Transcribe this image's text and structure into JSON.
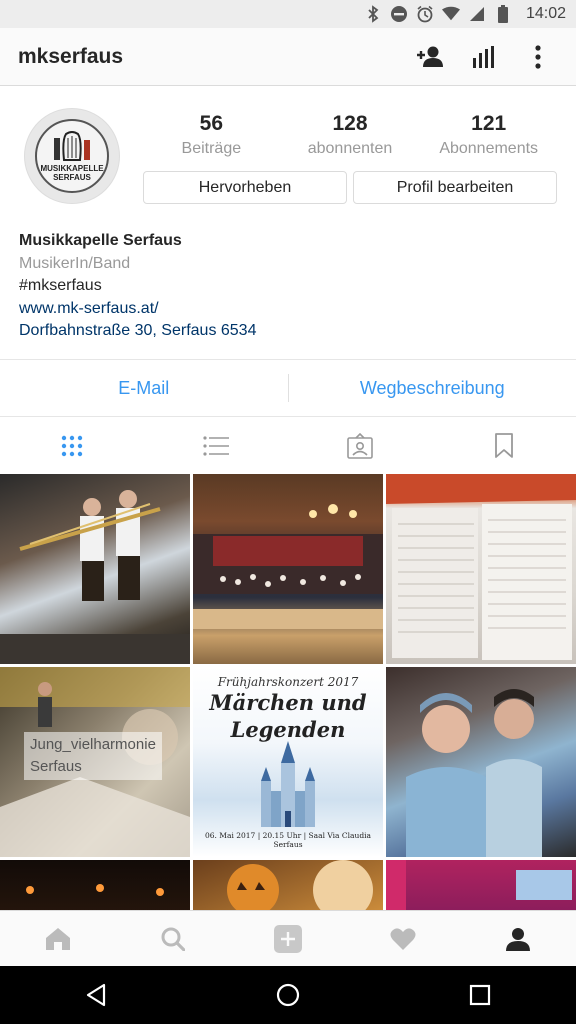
{
  "status_bar": {
    "time": "14:02",
    "icons": [
      "bluetooth-icon",
      "dnd-icon",
      "alarm-icon",
      "wifi-icon",
      "signal-icon",
      "battery-icon"
    ]
  },
  "header": {
    "username": "mkserfaus",
    "actions": [
      "add-person-icon",
      "insights-icon",
      "more-icon"
    ]
  },
  "avatar": {
    "label": "MUSIKKAPELLE",
    "sub": "SERFAUS"
  },
  "stats": [
    {
      "value": "56",
      "label": "Beiträge"
    },
    {
      "value": "128",
      "label": "abonnenten"
    },
    {
      "value": "121",
      "label": "Abonnements"
    }
  ],
  "buttons": {
    "promote": "Hervorheben",
    "edit_profile": "Profil bearbeiten"
  },
  "bio": {
    "name": "Musikkapelle Serfaus",
    "category": "MusikerIn/Band",
    "hashtag": "#mkserfaus",
    "website": "www.mk-serfaus.at/",
    "address": "Dorfbahnstraße 30, Serfaus 6534"
  },
  "contact": {
    "email": "E-Mail",
    "directions": "Wegbeschreibung"
  },
  "tabs": [
    "grid-icon",
    "list-icon",
    "tagged-icon",
    "saved-icon"
  ],
  "posts": {
    "p4_overlay_line1": "Jung_vielharmonie",
    "p4_overlay_line2": "Serfaus",
    "p5_kicker": "Frühjahrskonzert 2017",
    "p5_title_line1": "Märchen und",
    "p5_title_line2": "Legenden",
    "p5_footer": "06. Mai 2017 | 20.15 Uhr | Saal Via Claudia Serfaus"
  },
  "bottom_nav": [
    "home-icon",
    "search-icon",
    "add-post-icon",
    "activity-icon",
    "profile-icon"
  ],
  "colors": {
    "accent": "#3897f0",
    "link": "#003569",
    "muted": "#999999"
  }
}
